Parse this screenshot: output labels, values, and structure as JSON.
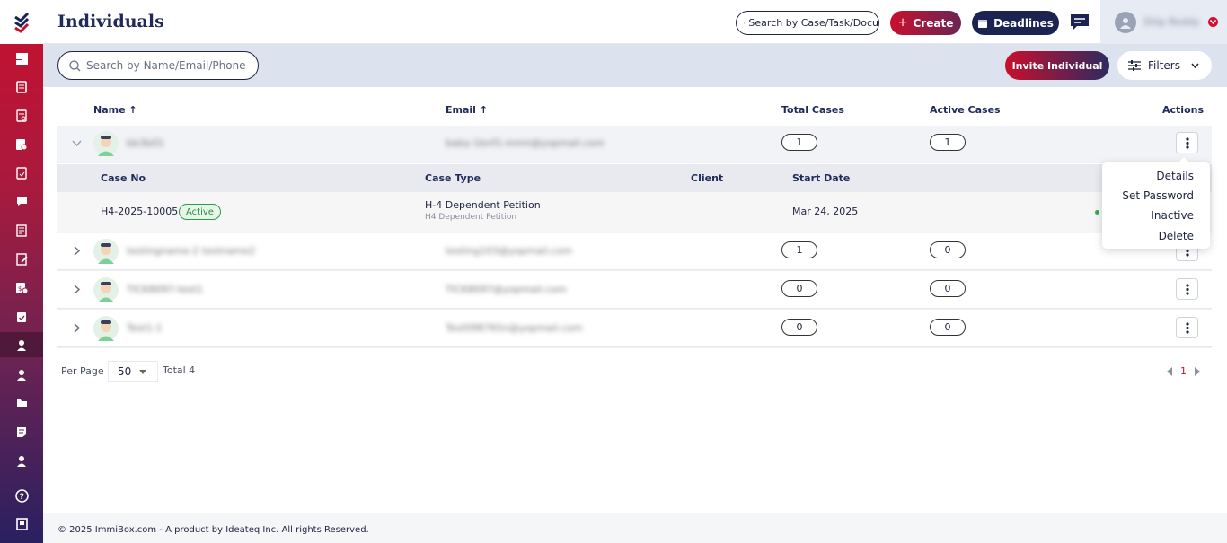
{
  "header": {
    "title": "Individuals",
    "global_search_placeholder": "Search by Case/Task/Docu",
    "create_label": "Create",
    "deadlines_label": "Deadlines",
    "user_name": "Dilip Reddy"
  },
  "sidebar": {
    "items": [
      "dashboard",
      "cases",
      "documents",
      "billing",
      "forms",
      "messages",
      "notes",
      "reports",
      "invoices",
      "tasks",
      "individuals",
      "contacts",
      "files",
      "templates",
      "users",
      "help",
      "guide"
    ],
    "active": "individuals"
  },
  "toolbar": {
    "search_placeholder": "Search by Name/Email/Phone",
    "invite_label": "Invite Individual",
    "filters_label": "Filters"
  },
  "table": {
    "headers": {
      "name": "Name",
      "email": "Email",
      "total_cases": "Total Cases",
      "active_cases": "Active Cases",
      "actions": "Actions"
    },
    "rows": [
      {
        "name": "bb3b01",
        "email": "baby-1bnf1-mmn@yopmail.com",
        "total": "1",
        "active": "1"
      },
      {
        "name": "testingname-2 testname2",
        "email": "testing103@yopmail.com",
        "total": "1",
        "active": "0"
      },
      {
        "name": "TICK8097-test1",
        "email": "TICK8097@yopmail.com",
        "total": "0",
        "active": "0"
      },
      {
        "name": "Test1-1",
        "email": "Test098765n@yopmail.com",
        "total": "0",
        "active": "0"
      }
    ]
  },
  "subtable": {
    "headers": {
      "case_no": "Case No",
      "case_type": "Case Type",
      "client": "Client",
      "start_date": "Start Date"
    },
    "row": {
      "case_no": "H4-2025-10005",
      "status": "Active",
      "case_type": "H-4 Dependent Petition",
      "case_type_sub": "H4 Dependent Petition",
      "start_date": "Mar 24, 2025"
    }
  },
  "actions_menu": {
    "details": "Details",
    "set_password": "Set Password",
    "inactive": "Inactive",
    "delete": "Delete"
  },
  "pagination": {
    "per_page_label": "Per Page",
    "per_page_value": "50",
    "total_label": "Total 4",
    "current_page": "1"
  },
  "footer": {
    "text": "© 2025 ImmiBox.com - A product by Ideateq Inc. All rights Reserved."
  },
  "colors": {
    "brand_red": "#c8102e",
    "brand_navy": "#1b2450",
    "active_green": "#2e9b45"
  }
}
